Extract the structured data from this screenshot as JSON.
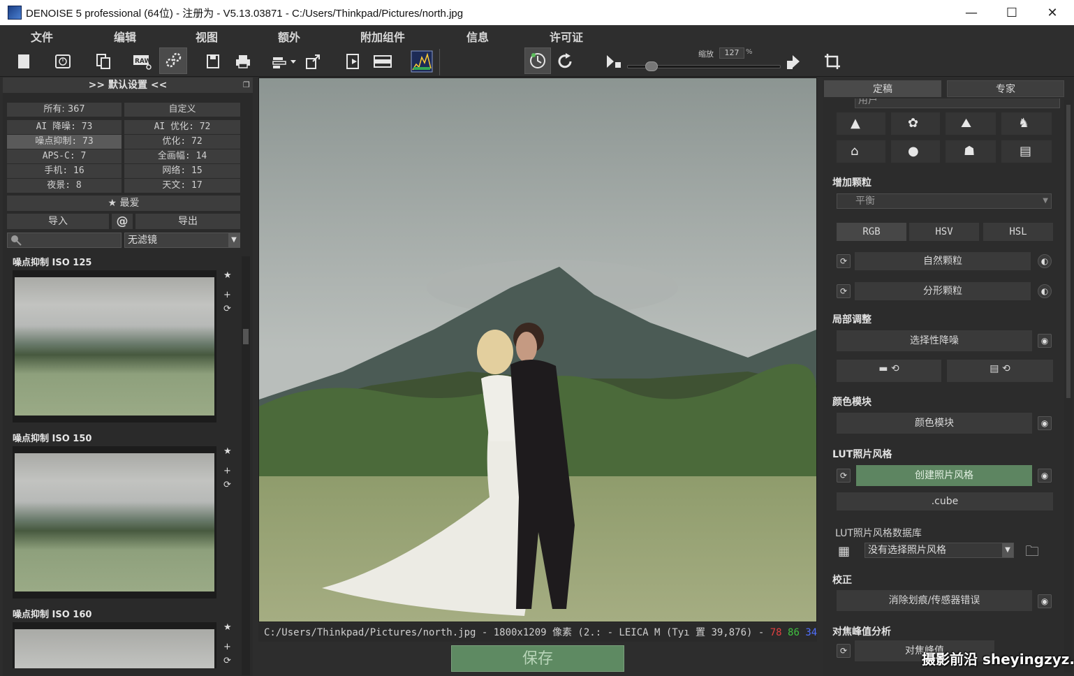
{
  "window": {
    "title": "DENOISE 5 professional (64位) - 注册为 - V5.13.03871 - C:/Users/Thinkpad/Pictures/north.jpg",
    "minimize": "—",
    "maximize": "☐",
    "close": "✕"
  },
  "menu": [
    "文件",
    "编辑",
    "视图",
    "额外",
    "附加组件",
    "信息",
    "许可证"
  ],
  "toolbar": {
    "zoom_label": "缩放",
    "zoom_value": "127",
    "zoom_unit": "%"
  },
  "left_panel": {
    "header": ">> 默认设置 <<",
    "categories": [
      [
        "所有: 367",
        "自定义"
      ],
      [
        "AI 降噪: 73",
        "AI 优化: 72"
      ],
      [
        "噪点抑制: 73",
        "优化: 72"
      ],
      [
        "APS-C: 7",
        "全画幅: 14"
      ],
      [
        "手机: 16",
        "网络: 15"
      ],
      [
        "夜景: 8",
        "天文: 17"
      ]
    ],
    "favorites": "★ 最爱",
    "import": "导入",
    "at": "@",
    "export": "导出",
    "filter_value": "无滤镜",
    "presets": [
      {
        "title": "噪点抑制 ISO 125"
      },
      {
        "title": "噪点抑制 ISO 150"
      },
      {
        "title": "噪点抑制 ISO 160"
      }
    ]
  },
  "status_bar": {
    "text": "C:/Users/Thinkpad/Pictures/north.jpg - 1800x1209 像素 (2.: - LEICA M (Tyı 置 39,876) -",
    "r": "78",
    "g": "86",
    "b": "34"
  },
  "save_button": "保存",
  "right_panel": {
    "tabs": [
      "定稿",
      "专家"
    ],
    "top_select": "用户",
    "grain_title": "增加颗粒",
    "grain_select": "平衡",
    "color_modes": [
      "RGB",
      "HSV",
      "HSL"
    ],
    "natural_grain": "自然颗粒",
    "fractal_grain": "分形颗粒",
    "local_title": "局部调整",
    "selective_denoise": "选择性降噪",
    "color_module_title": "颜色模块",
    "color_module": "颜色模块",
    "lut_title": "LUT照片风格",
    "create_style": "创建照片风格",
    "cube": ".cube",
    "lut_db_title": "LUT照片风格数据库",
    "lut_db_select": "没有选择照片风格",
    "correction_title": "校正",
    "remove_scratches": "消除划痕/传感器错误",
    "focus_title": "对焦峰值分析",
    "focus_peak": "对焦峰值"
  },
  "watermark": "摄影前沿 sheyingzyz.com"
}
